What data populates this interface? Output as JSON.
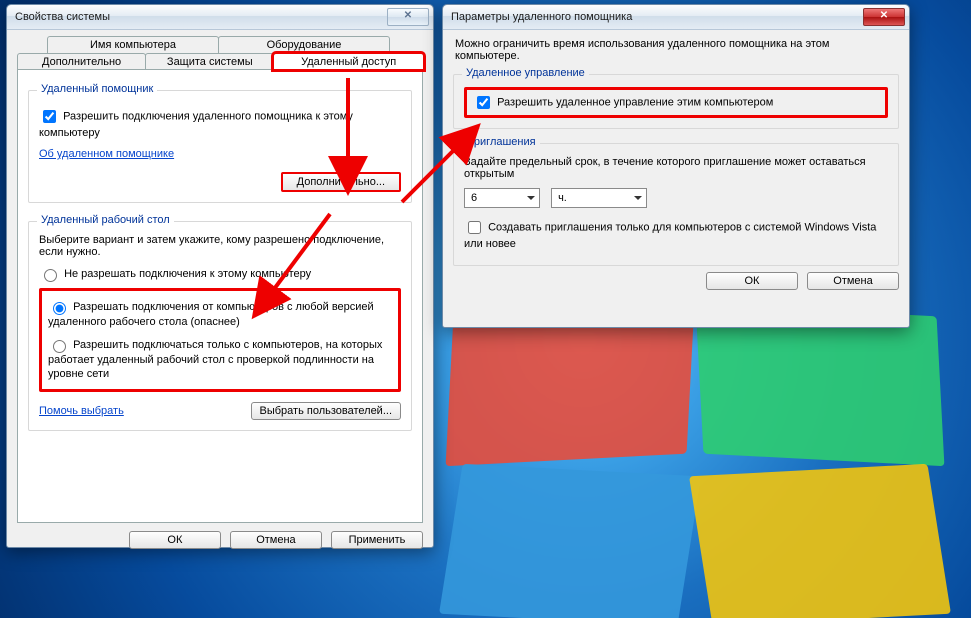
{
  "win1": {
    "title": "Свойства системы",
    "tabs_top": [
      "Имя компьютера",
      "Оборудование"
    ],
    "tabs_bottom": [
      "Дополнительно",
      "Защита системы",
      "Удаленный доступ"
    ],
    "group_assist": {
      "legend": "Удаленный помощник",
      "chk_label": "Разрешить подключения удаленного помощника к этому компьютеру",
      "link": "Об удаленном помощнике",
      "advanced_btn": "Дополнительно..."
    },
    "group_rdp": {
      "legend": "Удаленный рабочий стол",
      "instr": "Выберите вариант и затем укажите, кому разрешено подключение, если нужно.",
      "opt1": "Не разрешать подключения к этому компьютеру",
      "opt2": "Разрешать подключения от компьютеров с любой версией удаленного рабочего стола (опаснее)",
      "opt3": "Разрешить подключаться только с компьютеров, на которых работает удаленный рабочий стол с проверкой подлинности на уровне сети",
      "help_link": "Помочь выбрать",
      "select_users_btn": "Выбрать пользователей..."
    },
    "buttons": {
      "ok": "ОК",
      "cancel": "Отмена",
      "apply": "Применить"
    }
  },
  "win2": {
    "title": "Параметры удаленного помощника",
    "intro": "Можно ограничить время использования удаленного помощника на этом компьютере.",
    "group_control": {
      "legend": "Удаленное управление",
      "chk_label": "Разрешить удаленное управление этим компьютером"
    },
    "group_invite": {
      "legend": "Приглашения",
      "instr": "Задайте предельный срок, в течение которого приглашение может оставаться открытым",
      "num_value": "6",
      "unit_value": "ч.",
      "vista_chk": "Создавать приглашения только для компьютеров с системой Windows Vista или новее"
    },
    "buttons": {
      "ok": "ОК",
      "cancel": "Отмена"
    }
  }
}
